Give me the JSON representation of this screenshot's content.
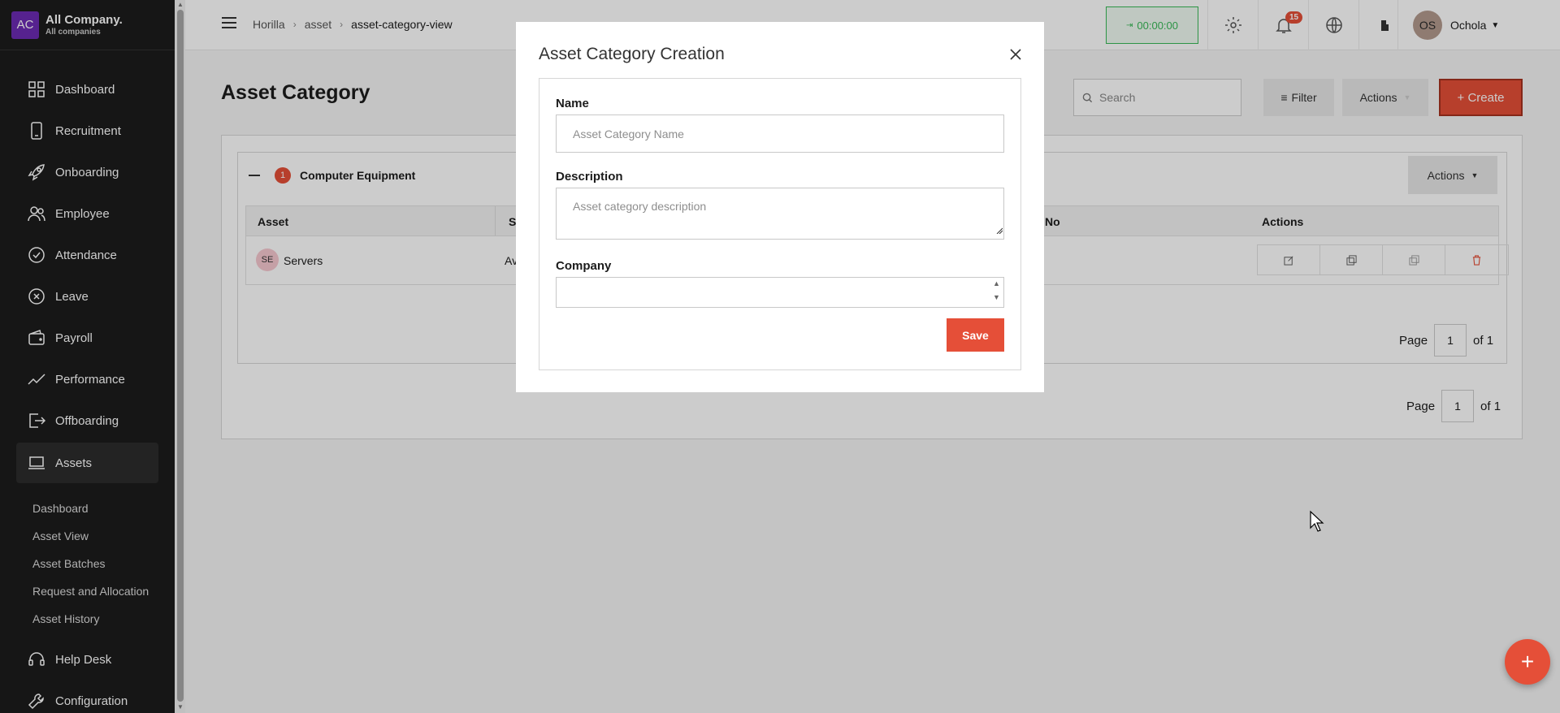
{
  "company": {
    "logo": "AC",
    "name": "All Company.",
    "subtitle": "All companies"
  },
  "sidebar": {
    "items": [
      {
        "label": "Dashboard",
        "icon": "grid-icon"
      },
      {
        "label": "Recruitment",
        "icon": "phone-icon"
      },
      {
        "label": "Onboarding",
        "icon": "rocket-icon"
      },
      {
        "label": "Employee",
        "icon": "people-icon"
      },
      {
        "label": "Attendance",
        "icon": "check-circle-icon"
      },
      {
        "label": "Leave",
        "icon": "x-circle-icon"
      },
      {
        "label": "Payroll",
        "icon": "wallet-icon"
      },
      {
        "label": "Performance",
        "icon": "trend-icon"
      },
      {
        "label": "Offboarding",
        "icon": "exit-icon"
      },
      {
        "label": "Assets",
        "icon": "laptop-icon"
      }
    ],
    "sub_items": [
      "Dashboard",
      "Asset View",
      "Asset Batches",
      "Request and Allocation",
      "Asset History"
    ],
    "bottom_items": [
      {
        "label": "Help Desk",
        "icon": "headset-icon"
      },
      {
        "label": "Configuration",
        "icon": "wrench-icon"
      }
    ]
  },
  "header": {
    "breadcrumb": [
      "Horilla",
      "asset",
      "asset-category-view"
    ],
    "timer": "00:00:00",
    "notification_count": "15",
    "user_initials": "OS",
    "user_name": "Ochola"
  },
  "main": {
    "title": "Asset Category",
    "search_placeholder": "Search",
    "filter_label": "Filter",
    "actions_label": "Actions",
    "create_label": "+ Create",
    "group": {
      "count": "1",
      "name": "Computer Equipment",
      "actions_label": "Actions",
      "columns": [
        "Asset",
        "S",
        "No",
        "Actions"
      ],
      "rows": [
        {
          "initials": "SE",
          "name": "Servers",
          "status": "Av"
        }
      ],
      "page_label": "Page",
      "page": "1",
      "page_of": "of 1"
    },
    "page_label": "Page",
    "page": "1",
    "page_of": "of 1"
  },
  "modal": {
    "title": "Asset Category Creation",
    "name_label": "Name",
    "name_placeholder": "Asset Category Name",
    "description_label": "Description",
    "description_placeholder": "Asset category description",
    "company_label": "Company",
    "company_value": "",
    "save_label": "Save"
  },
  "colors": {
    "accent": "#e54f38",
    "sidebar": "#1c1c1c",
    "timer": "#38b957",
    "company_logo": "#6c2bb3"
  }
}
